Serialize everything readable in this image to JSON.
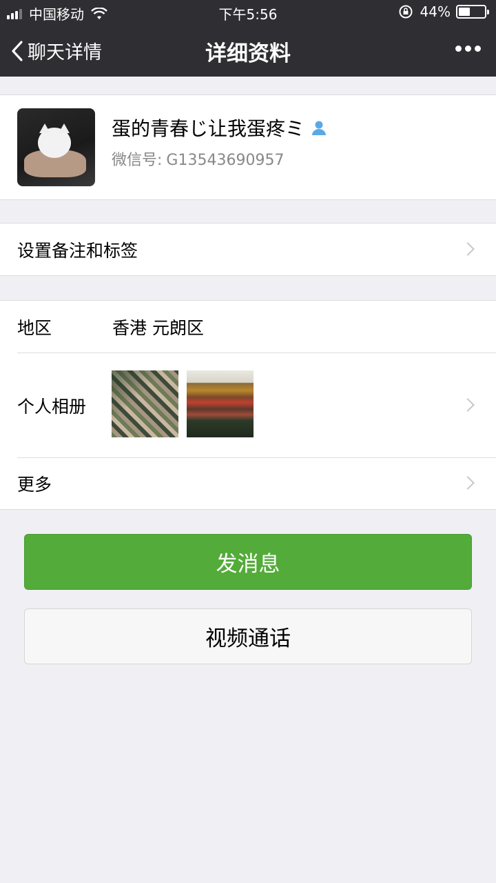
{
  "status_bar": {
    "carrier": "中国移动",
    "time": "下午5:56",
    "battery_percent_text": "44%",
    "battery_level": 0.44
  },
  "nav": {
    "back_label": "聊天详情",
    "title": "详细资料"
  },
  "profile": {
    "name": "蛋的青春じ让我蛋疼ミ",
    "wechat_id_label": "微信号:",
    "wechat_id": "G13543690957"
  },
  "remark_row": {
    "label": "设置备注和标签"
  },
  "info": {
    "region_label": "地区",
    "region_value": "香港 元朗区",
    "album_label": "个人相册",
    "more_label": "更多"
  },
  "actions": {
    "send_message": "发消息",
    "video_call": "视频通话"
  },
  "colors": {
    "nav_bg": "#2e2e33",
    "primary_green": "#53ab3a",
    "page_bg": "#efeff4",
    "secondary_text": "#888888"
  }
}
